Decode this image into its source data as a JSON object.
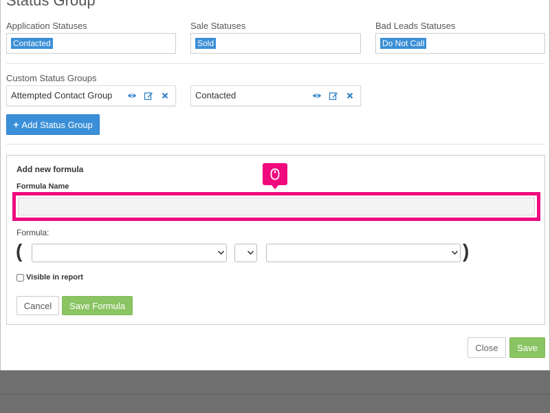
{
  "modal": {
    "title": "Status Group",
    "application_statuses": {
      "label": "Application Statuses",
      "tags": [
        "Contacted"
      ]
    },
    "sale_statuses": {
      "label": "Sale Statuses",
      "tags": [
        "Sold"
      ]
    },
    "bad_leads_statuses": {
      "label": "Bad Leads Statuses",
      "tags": [
        "Do Not Call"
      ]
    },
    "custom_groups": {
      "label": "Custom Status Groups",
      "items": [
        {
          "name": "Attempted Contact Group"
        },
        {
          "name": "Contacted"
        }
      ]
    },
    "add_status_group": {
      "icon": "+",
      "label": "Add Status Group"
    },
    "formula_panel": {
      "title": "Add new formula",
      "name_label": "Formula Name",
      "name_value": "",
      "formula_label": "Formula:",
      "open_paren": "(",
      "close_paren": ")",
      "visible_label": "Visible in report",
      "visible_checked": false,
      "cancel_label": "Cancel",
      "save_formula_label": "Save Formula"
    },
    "footer": {
      "close_label": "Close",
      "save_label": "Save"
    }
  },
  "colors": {
    "tag": "#3b8fd6",
    "primary": "#3a8fd8",
    "success": "#8bc463",
    "highlight": "#ef0a7e",
    "backdrop": "#6b6b6b"
  },
  "icons": {
    "group_actions": [
      "eye-icon",
      "edit-icon",
      "close-icon"
    ],
    "cursor_indicator": "mouse-icon"
  }
}
